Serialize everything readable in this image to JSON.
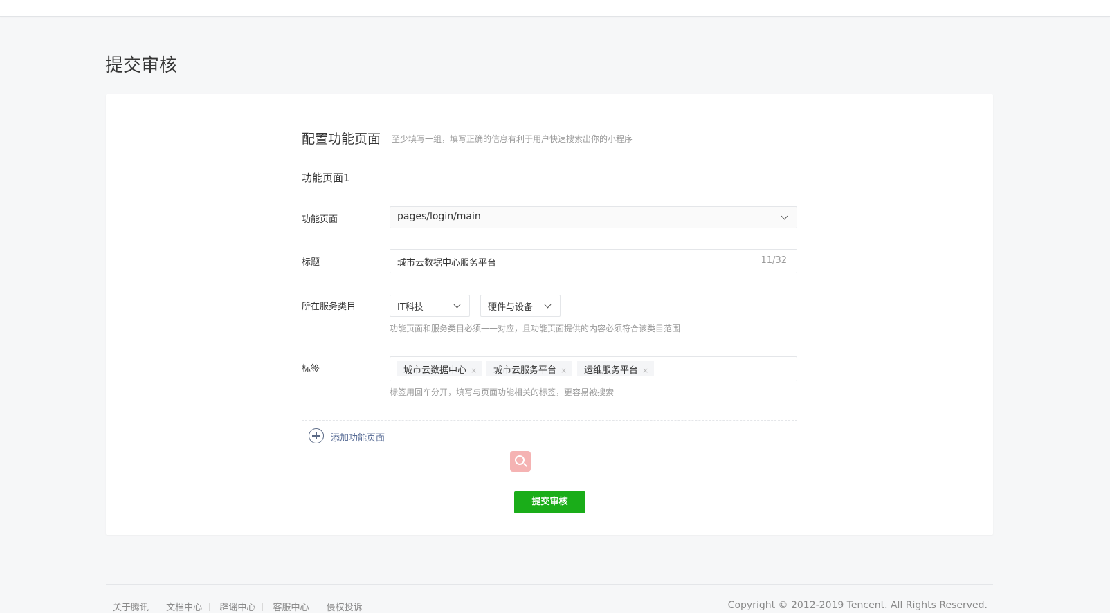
{
  "page": {
    "title": "提交审核"
  },
  "section": {
    "title": "配置功能页面",
    "hint": "至少填写一组，填写正确的信息有利于用户快速搜索出你的小程序"
  },
  "group": {
    "title": "功能页面1",
    "fields": {
      "page_label": "功能页面",
      "page_value": "pages/login/main",
      "title_label": "标题",
      "title_value": "城市云数据中心服务平台",
      "title_counter": "11/32",
      "category_label": "所在服务类目",
      "category_primary": "IT科技",
      "category_secondary": "硬件与设备",
      "category_hint": "功能页面和服务类目必须一一对应，且功能页面提供的内容必须符合该类目范围",
      "tags_label": "标签",
      "tags": [
        "城市云数据中心",
        "城市云服务平台",
        "运维服务平台"
      ],
      "tags_hint": "标签用回车分开，填写与页面功能相关的标签，更容易被搜索"
    }
  },
  "actions": {
    "add_page": "添加功能页面",
    "submit": "提交审核"
  },
  "footer": {
    "links": [
      "关于腾讯",
      "文档中心",
      "辟谣中心",
      "客服中心",
      "侵权投诉"
    ],
    "copyright": "Copyright © 2012-2019 Tencent. All Rights Reserved."
  },
  "colors": {
    "primary_green": "#1aad19",
    "link_blue": "#576b95",
    "background": "#f6f7f8"
  }
}
